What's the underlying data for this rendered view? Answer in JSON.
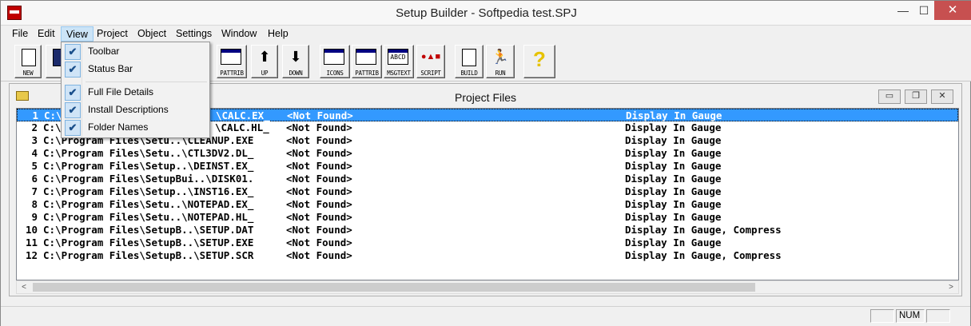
{
  "window": {
    "title": "Setup Builder - Softpedia test.SPJ",
    "min_glyph": "—",
    "max_glyph": "☐",
    "close_glyph": "✕"
  },
  "menu": [
    "File",
    "Edit",
    "View",
    "Project",
    "Object",
    "Settings",
    "Window",
    "Help"
  ],
  "toolbar": {
    "buttons": [
      "NEW",
      "PATTRIB",
      "UP",
      "DOWN",
      "ICONS",
      "PATTRIB",
      "MSGTEXT",
      "SCRIPT",
      "BUILD",
      "RUN"
    ],
    "arrows": {
      "up": "⬆",
      "down": "⬇"
    },
    "icon_text": {
      "msgtext": "ABCD",
      "script": "●▲■",
      "run": "🏃",
      "help": "?"
    }
  },
  "dropdown": {
    "items": [
      {
        "label": "Toolbar",
        "checked": true
      },
      {
        "label": "Status Bar",
        "checked": true
      },
      {
        "label": "Full File Details",
        "checked": true
      },
      {
        "label": "Install Descriptions",
        "checked": true
      },
      {
        "label": "Folder Names",
        "checked": true
      }
    ],
    "check_glyph": "✔"
  },
  "child": {
    "title": "Project Files",
    "buttons": {
      "minimize": "▭",
      "restore": "❐",
      "close": "✕"
    }
  },
  "files": [
    {
      "num": "1",
      "path": "C:\\...",
      "name": "\\CALC.EX_",
      "status": "<Not Found>",
      "opts": "Display In Gauge"
    },
    {
      "num": "2",
      "path": "C:\\...",
      "name": "\\CALC.HL_",
      "status": "<Not Found>",
      "opts": "Display In Gauge"
    },
    {
      "num": "3",
      "path": "C:\\Program Files\\Setu..\\CLEANUP.EXE",
      "status": "<Not Found>",
      "opts": "Display In Gauge"
    },
    {
      "num": "4",
      "path": "C:\\Program Files\\Setu..\\CTL3DV2.DL_",
      "status": "<Not Found>",
      "opts": "Display In Gauge"
    },
    {
      "num": "5",
      "path": "C:\\Program Files\\Setup..\\DEINST.EX_",
      "status": "<Not Found>",
      "opts": "Display In Gauge"
    },
    {
      "num": "6",
      "path": "C:\\Program Files\\SetupBui..\\DISK01.",
      "status": "<Not Found>",
      "opts": "Display In Gauge"
    },
    {
      "num": "7",
      "path": "C:\\Program Files\\Setup..\\INST16.EX_",
      "status": "<Not Found>",
      "opts": "Display In Gauge"
    },
    {
      "num": "8",
      "path": "C:\\Program Files\\Setu..\\NOTEPAD.EX_",
      "status": "<Not Found>",
      "opts": "Display In Gauge"
    },
    {
      "num": "9",
      "path": "C:\\Program Files\\Setu..\\NOTEPAD.HL_",
      "status": "<Not Found>",
      "opts": "Display In Gauge"
    },
    {
      "num": "10",
      "path": "C:\\Program Files\\SetupB..\\SETUP.DAT",
      "status": "<Not Found>",
      "opts": "Display In Gauge, Compress"
    },
    {
      "num": "11",
      "path": "C:\\Program Files\\SetupB..\\SETUP.EXE",
      "status": "<Not Found>",
      "opts": "Display In Gauge"
    },
    {
      "num": "12",
      "path": "C:\\Program Files\\SetupB..\\SETUP.SCR",
      "status": "<Not Found>",
      "opts": "Display In Gauge, Compress"
    }
  ],
  "scroll": {
    "left": "<",
    "right": ">"
  },
  "statusbar": {
    "num": "NUM"
  }
}
